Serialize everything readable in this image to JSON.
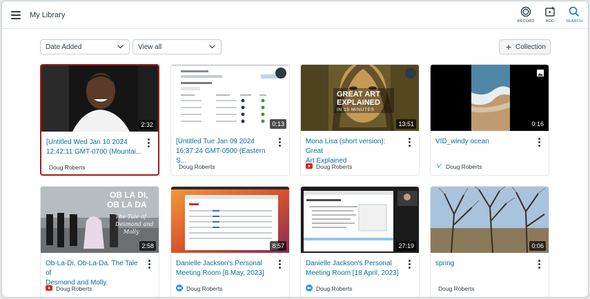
{
  "header": {
    "title": "My Library"
  },
  "toolbar": {
    "record_label": "RECORD",
    "add_label": "ADD",
    "search_label": "SEARCH"
  },
  "filters": {
    "sort_value": "Date Added",
    "view_value": "View all",
    "collection_label": "Collection"
  },
  "colors": {
    "link": "#0770a3",
    "selected_border": "#a31c1c",
    "text": "#2d3b45"
  },
  "cards": [
    {
      "title": "[Untitled Wed Jan 10 2024\n12:42:11 GMT-0700 (Mountai...",
      "duration": "2:32",
      "owner": "Doug Roberts"
    },
    {
      "title": "[Untitled Tue Jan 09 2024\n16:37:24 GMT-0500 (Eastern S...",
      "duration": "0:13",
      "owner": "Doug Roberts"
    },
    {
      "title": "Mona Lisa (short version): Great\nArt Explained",
      "duration": "13:51",
      "owner": "Doug Roberts",
      "source_icon": "youtube-icon",
      "thumb_text": [
        "GREAT ART",
        "EXPLAINED",
        "IN 15 MINUTES"
      ]
    },
    {
      "title": "VID_windy ocean",
      "duration": "0:16",
      "owner": "Doug Roberts",
      "source_icon": "vimeo-icon"
    },
    {
      "title": "Ob-La-Di, Ob-La-Da. The Tale of\nDesmond and Molly.",
      "duration": "2:58",
      "owner": "Doug Roberts",
      "source_icon": "youtube-icon",
      "thumb_text": [
        "OB LA DI,",
        "OB LA DA",
        "The Tale of",
        "Desmond and",
        "Molly"
      ]
    },
    {
      "title": "Danielle Jackson's Personal\nMeeting Room [8 May, 2023]",
      "duration": "8:57",
      "owner": "Doug Roberts",
      "source_icon": "zoom-icon"
    },
    {
      "title": "Danielle Jackson's Personal\nMeeting Room [18 April, 2023]",
      "duration": "27:19",
      "owner": "Doug Roberts",
      "source_icon": "zoom-icon"
    },
    {
      "title": "spring",
      "duration": "0:06",
      "owner": "Doug Roberts"
    }
  ]
}
